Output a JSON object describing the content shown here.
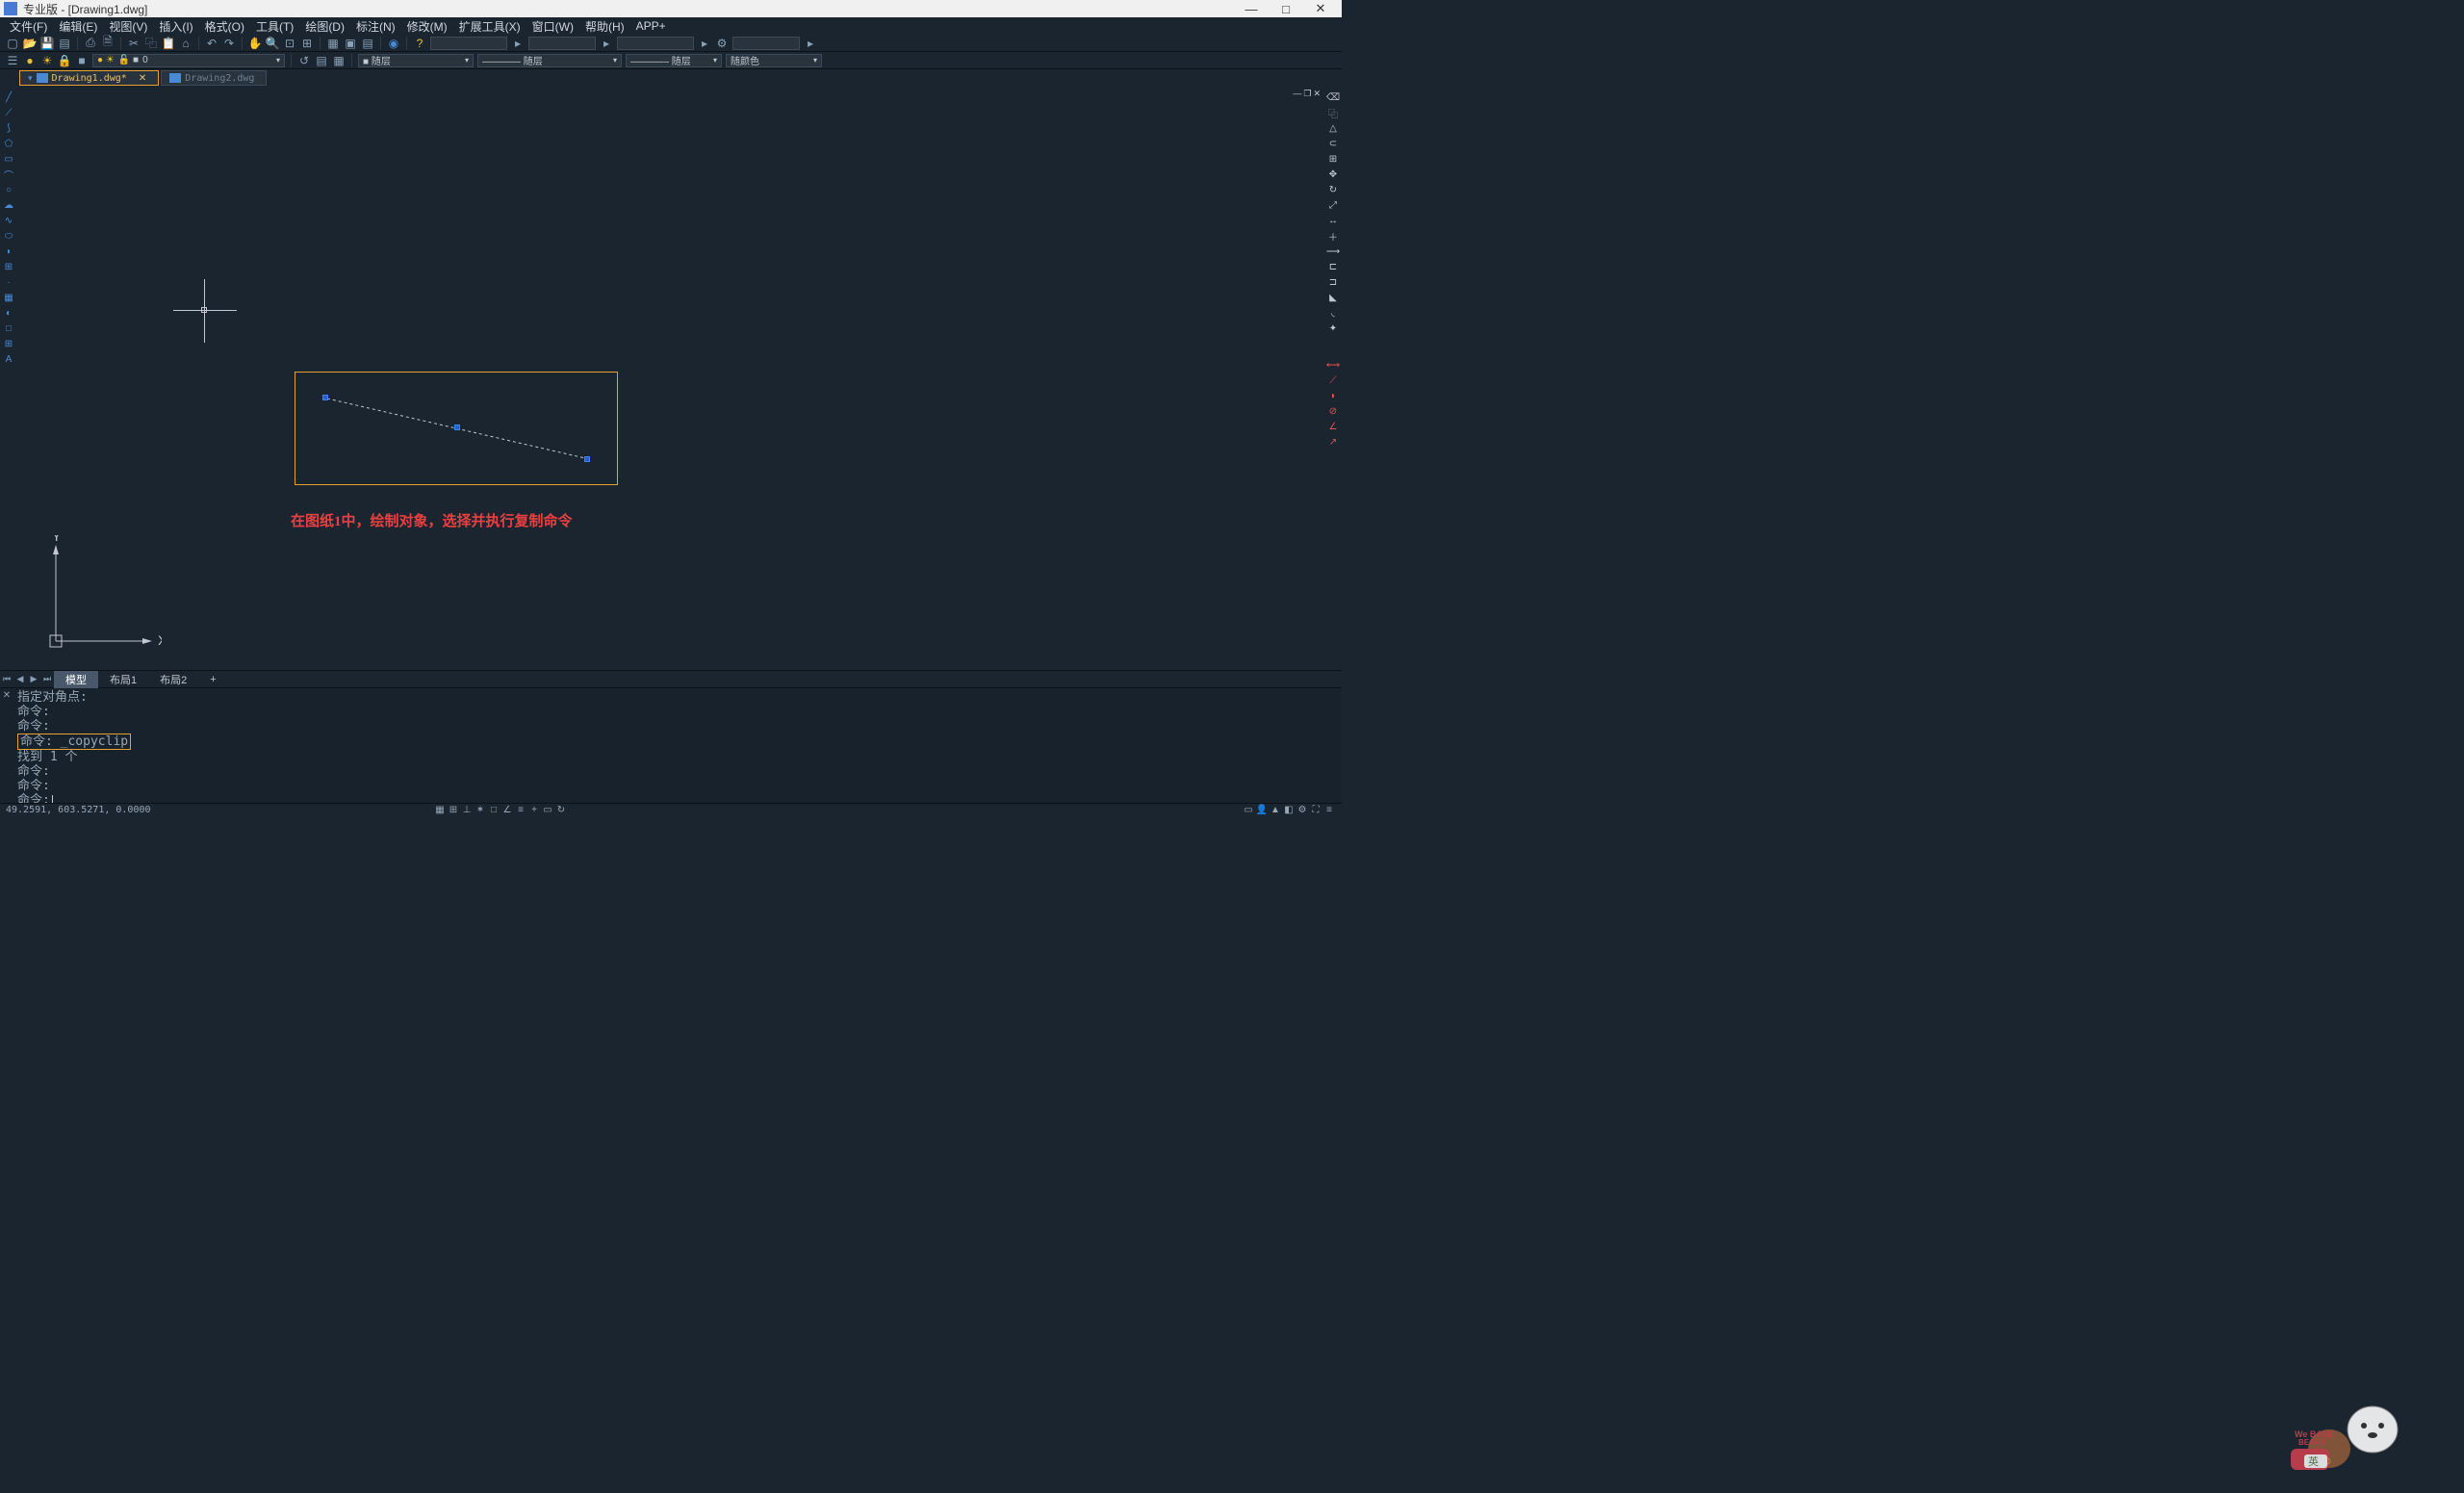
{
  "titlebar": {
    "title": "专业版 - [Drawing1.dwg]"
  },
  "window_controls": {
    "min": "—",
    "max": "□",
    "close": "✕"
  },
  "menus": [
    "文件(F)",
    "编辑(E)",
    "视图(V)",
    "插入(I)",
    "格式(O)",
    "工具(T)",
    "绘图(D)",
    "标注(N)",
    "修改(M)",
    "扩展工具(X)",
    "窗口(W)",
    "帮助(H)",
    "APP+"
  ],
  "toolbar2": {
    "layer": "0",
    "prop1": "■ 随层",
    "prop2": "———— 随层",
    "prop3": "———— 随层",
    "prop4": "随颜色"
  },
  "tabs": {
    "active": "Drawing1.dwg*",
    "other": "Drawing2.dwg"
  },
  "annotation": "在图纸1中，绘制对象，选择并执行复制命令",
  "layout_tabs": {
    "model": "模型",
    "layout1": "布局1",
    "layout2": "布局2",
    "plus": "+"
  },
  "command": {
    "l1": "指定对角点:",
    "l2": "命令:",
    "l3": "命令:",
    "hi": "命令: _copyclip",
    "l4": "找到 1 个",
    "l5": "命令:",
    "l6": "命令:",
    "prompt": "命令:"
  },
  "status": {
    "coords": "49.2591, 603.5271, 0.0000",
    "lang": "英"
  },
  "ucs": {
    "x": "X",
    "y": "Y"
  }
}
